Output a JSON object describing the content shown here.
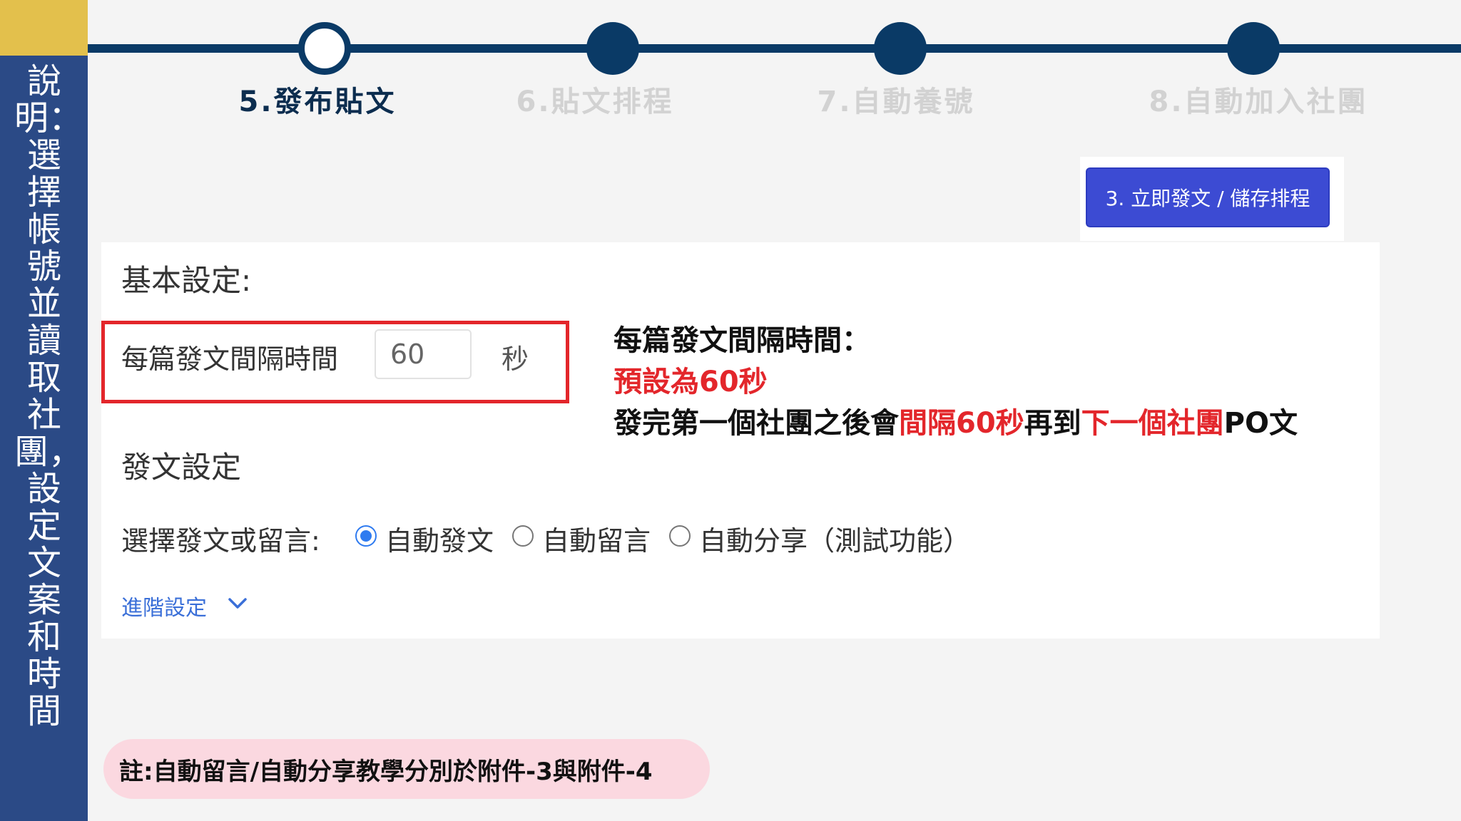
{
  "sidebar": {
    "title": "說明：選擇帳號並讀取社團，設定文案和時間"
  },
  "stepper": {
    "steps": [
      {
        "label": "5.發布貼文",
        "current": true
      },
      {
        "label": "6.貼文排程",
        "current": false
      },
      {
        "label": "7.自動養號",
        "current": false
      },
      {
        "label": "8.自動加入社團",
        "current": false
      }
    ]
  },
  "toolbar": {
    "save_label": "3. 立即發文 / 儲存排程"
  },
  "basic_settings": {
    "heading": "基本設定:",
    "interval_label": "每篇發文間隔時間",
    "interval_value": "60",
    "interval_unit": "秒"
  },
  "annotation": {
    "title": "每篇發文間隔時間：",
    "default_text": "預設為60秒",
    "line3_part1": "發完第一個社團之後會",
    "line3_red1": "間隔60秒",
    "line3_part2": "再到",
    "line3_red2": "下一個社團",
    "line3_part3": "PO文"
  },
  "post_settings": {
    "heading": "發文設定",
    "choose_label": "選擇發文或留言:",
    "options": [
      {
        "label": "自動發文",
        "checked": true
      },
      {
        "label": "自動留言",
        "checked": false
      },
      {
        "label": "自動分享（測試功能）",
        "checked": false
      }
    ],
    "advanced_label": "進階設定"
  },
  "note": {
    "text": "註:自動留言/自動分享教學分別於附件-3與附件-4"
  },
  "colors": {
    "accent_red": "#e3262b",
    "brand_navy": "#0a3a66",
    "button_blue": "#3c4bd3",
    "radio_blue": "#2f7bf0"
  }
}
